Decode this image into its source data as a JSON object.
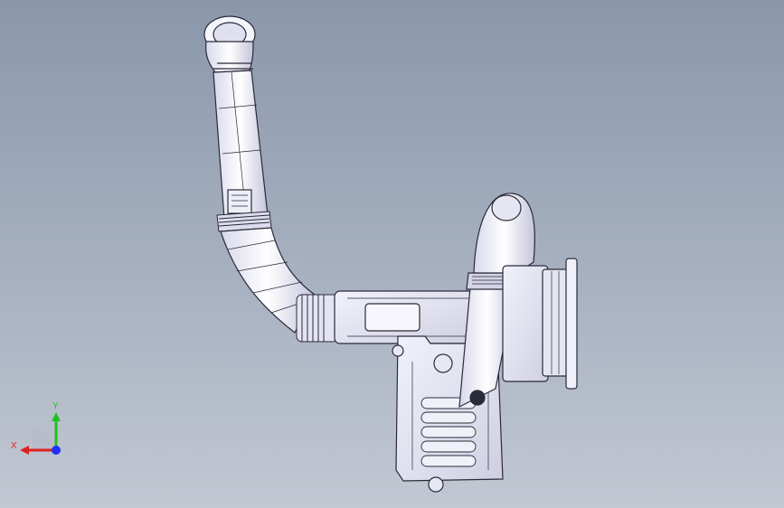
{
  "viewport": {
    "background_top": "#8a97ab",
    "background_bottom": "#c2c8d2",
    "model_icon": "air-intake-duct-assembly"
  },
  "triad": {
    "x_label": "X",
    "y_label": "Y",
    "x_color": "#e02020",
    "y_color": "#20c020",
    "z_color": "#2030ff"
  }
}
